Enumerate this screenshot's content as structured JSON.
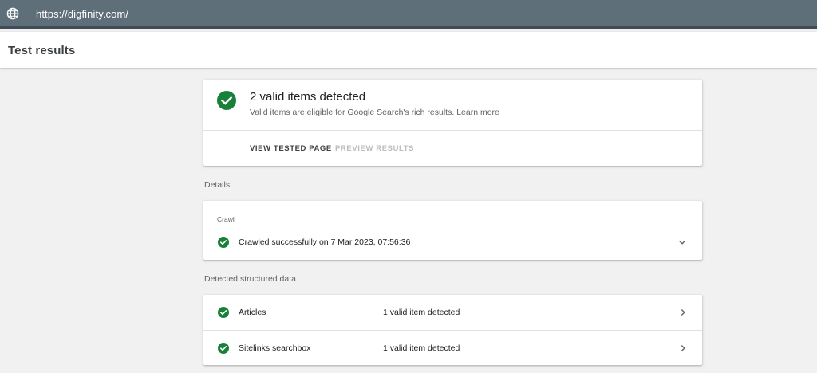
{
  "topbar": {
    "url": "https://digfinity.com/",
    "icon": "globe-icon"
  },
  "header": {
    "title": "Test results"
  },
  "summary": {
    "title": "2 valid items detected",
    "description": "Valid items are eligible for Google Search's rich results.",
    "learn_more": "Learn more",
    "view_tested_page": "VIEW TESTED PAGE",
    "preview_results": "PREVIEW RESULTS",
    "icon": "check-circle-icon"
  },
  "details": {
    "label": "Details",
    "crawl": {
      "label": "Crawl",
      "status": "Crawled successfully on 7 Mar 2023, 07:56:36"
    }
  },
  "structured_data": {
    "label": "Detected structured data",
    "items": [
      {
        "name": "Articles",
        "status": "1 valid item detected"
      },
      {
        "name": "Sitelinks searchbox",
        "status": "1 valid item detected"
      }
    ]
  },
  "colors": {
    "success": "#188038",
    "topbar": "#5f6f7a",
    "topbar_border": "#3f4c56",
    "background": "#f1f1f1"
  }
}
